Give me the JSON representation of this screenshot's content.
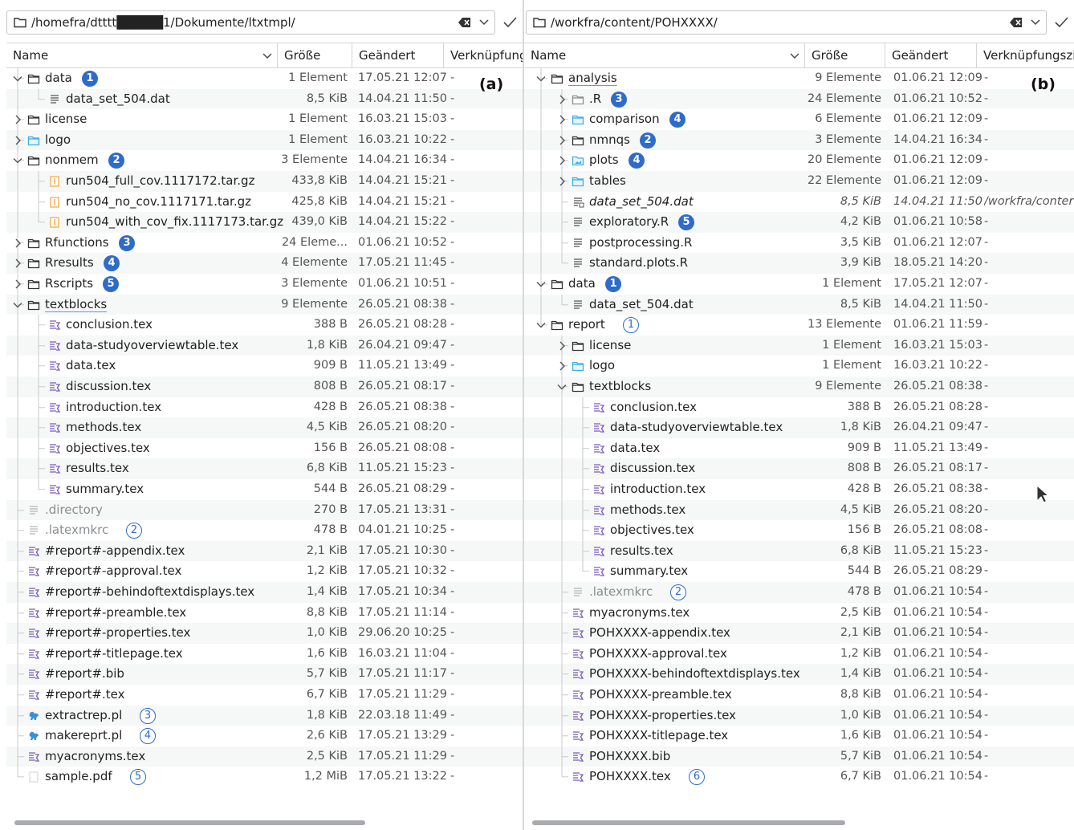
{
  "columns": {
    "name": "Name",
    "size": "Größe",
    "modified": "Geändert",
    "link_a": "Verknüpfung",
    "link_b": "Verknüpfungszi"
  },
  "left": {
    "path": "/homefra/dtttt█████1/Dokumente/ltxtmpl/",
    "label": "(a)",
    "rows": [
      {
        "d": 0,
        "exp": "open",
        "icon": "folder",
        "name": "data",
        "size": "1 Element",
        "date": "17.05.21 12:07",
        "link": "-",
        "badge": "1",
        "bt": "filled"
      },
      {
        "d": 1,
        "exp": "",
        "icon": "text",
        "name": "data_set_504.dat",
        "size": "8,5 KiB",
        "date": "14.04.21 11:50",
        "link": "-"
      },
      {
        "d": 0,
        "exp": "closed",
        "icon": "folder",
        "name": "license",
        "size": "1 Element",
        "date": "16.03.21 15:03",
        "link": "-"
      },
      {
        "d": 0,
        "exp": "closed",
        "icon": "folder-blue",
        "name": "logo",
        "size": "1 Element",
        "date": "16.03.21 10:22",
        "link": "-"
      },
      {
        "d": 0,
        "exp": "open",
        "icon": "folder",
        "name": "nonmem",
        "size": "3 Elemente",
        "date": "14.04.21 16:34",
        "link": "-",
        "badge": "2",
        "bt": "filled"
      },
      {
        "d": 1,
        "exp": "",
        "icon": "archive",
        "name": "run504_full_cov.1117172.tar.gz",
        "size": "433,8 KiB",
        "date": "14.04.21 15:21",
        "link": "-"
      },
      {
        "d": 1,
        "exp": "",
        "icon": "archive",
        "name": "run504_no_cov.1117171.tar.gz",
        "size": "425,8 KiB",
        "date": "14.04.21 15:21",
        "link": "-"
      },
      {
        "d": 1,
        "exp": "",
        "icon": "archive",
        "name": "run504_with_cov_fix.1117173.tar.gz",
        "size": "439,0 KiB",
        "date": "14.04.21 15:22",
        "link": "-"
      },
      {
        "d": 0,
        "exp": "closed",
        "icon": "folder",
        "name": "Rfunctions",
        "size": "24 Eleme...",
        "date": "01.06.21 10:52",
        "link": "-",
        "badge": "3",
        "bt": "filled"
      },
      {
        "d": 0,
        "exp": "closed",
        "icon": "folder",
        "name": "Rresults",
        "size": "4 Elemente",
        "date": "17.05.21 11:45",
        "link": "-",
        "badge": "4",
        "bt": "filled"
      },
      {
        "d": 0,
        "exp": "closed",
        "icon": "folder",
        "name": "Rscripts",
        "size": "3 Elemente",
        "date": "01.06.21 10:51",
        "link": "-",
        "badge": "5",
        "bt": "filled"
      },
      {
        "d": 0,
        "exp": "open",
        "icon": "folder",
        "name": "textblocks",
        "size": "9 Elemente",
        "date": "26.05.21 08:38",
        "link": "-",
        "under": true
      },
      {
        "d": 1,
        "exp": "",
        "icon": "tex",
        "name": "conclusion.tex",
        "size": "388 B",
        "date": "26.05.21 08:28",
        "link": "-"
      },
      {
        "d": 1,
        "exp": "",
        "icon": "tex",
        "name": "data-studyoverviewtable.tex",
        "size": "1,8 KiB",
        "date": "26.04.21 09:47",
        "link": "-"
      },
      {
        "d": 1,
        "exp": "",
        "icon": "tex",
        "name": "data.tex",
        "size": "909 B",
        "date": "11.05.21 13:49",
        "link": "-"
      },
      {
        "d": 1,
        "exp": "",
        "icon": "tex",
        "name": "discussion.tex",
        "size": "808 B",
        "date": "26.05.21 08:17",
        "link": "-"
      },
      {
        "d": 1,
        "exp": "",
        "icon": "tex",
        "name": "introduction.tex",
        "size": "428 B",
        "date": "26.05.21 08:38",
        "link": "-"
      },
      {
        "d": 1,
        "exp": "",
        "icon": "tex",
        "name": "methods.tex",
        "size": "4,5 KiB",
        "date": "26.05.21 08:20",
        "link": "-"
      },
      {
        "d": 1,
        "exp": "",
        "icon": "tex",
        "name": "objectives.tex",
        "size": "156 B",
        "date": "26.05.21 08:08",
        "link": "-"
      },
      {
        "d": 1,
        "exp": "",
        "icon": "tex",
        "name": "results.tex",
        "size": "6,8 KiB",
        "date": "11.05.21 15:23",
        "link": "-"
      },
      {
        "d": 1,
        "exp": "",
        "icon": "tex",
        "name": "summary.tex",
        "size": "544 B",
        "date": "26.05.21 08:29",
        "link": "-"
      },
      {
        "d": 0,
        "exp": "",
        "icon": "text-dim",
        "name": ".directory",
        "size": "270 B",
        "date": "17.05.21 13:31",
        "link": "-",
        "dim": true
      },
      {
        "d": 0,
        "exp": "",
        "icon": "text-dim",
        "name": ".latexmkrc",
        "size": "478 B",
        "date": "04.01.21 10:25",
        "link": "-",
        "dim": true,
        "badge": "2",
        "bt": "outline"
      },
      {
        "d": 0,
        "exp": "",
        "icon": "tex",
        "name": "#report#-appendix.tex",
        "size": "2,1 KiB",
        "date": "17.05.21 10:30",
        "link": "-"
      },
      {
        "d": 0,
        "exp": "",
        "icon": "tex",
        "name": "#report#-approval.tex",
        "size": "1,2 KiB",
        "date": "17.05.21 10:32",
        "link": "-"
      },
      {
        "d": 0,
        "exp": "",
        "icon": "tex",
        "name": "#report#-behindoftextdisplays.tex",
        "size": "1,4 KiB",
        "date": "17.05.21 10:34",
        "link": "-"
      },
      {
        "d": 0,
        "exp": "",
        "icon": "tex",
        "name": "#report#-preamble.tex",
        "size": "8,8 KiB",
        "date": "17.05.21 11:14",
        "link": "-"
      },
      {
        "d": 0,
        "exp": "",
        "icon": "tex",
        "name": "#report#-properties.tex",
        "size": "1,0 KiB",
        "date": "29.06.20 10:25",
        "link": "-"
      },
      {
        "d": 0,
        "exp": "",
        "icon": "tex",
        "name": "#report#-titlepage.tex",
        "size": "1,6 KiB",
        "date": "16.03.21 11:04",
        "link": "-"
      },
      {
        "d": 0,
        "exp": "",
        "icon": "tex",
        "name": "#report#.bib",
        "size": "5,7 KiB",
        "date": "17.05.21 11:17",
        "link": "-"
      },
      {
        "d": 0,
        "exp": "",
        "icon": "tex",
        "name": "#report#.tex",
        "size": "6,7 KiB",
        "date": "17.05.21 11:29",
        "link": "-"
      },
      {
        "d": 0,
        "exp": "",
        "icon": "perl",
        "name": "extractrep.pl",
        "size": "1,8 KiB",
        "date": "22.03.18 11:49",
        "link": "-",
        "badge": "3",
        "bt": "outline"
      },
      {
        "d": 0,
        "exp": "",
        "icon": "perl",
        "name": "makereprt.pl",
        "size": "2,6 KiB",
        "date": "17.05.21 13:29",
        "link": "-",
        "badge": "4",
        "bt": "outline"
      },
      {
        "d": 0,
        "exp": "",
        "icon": "tex",
        "name": "myacronyms.tex",
        "size": "2,5 KiB",
        "date": "17.05.21 11:29",
        "link": "-"
      },
      {
        "d": 0,
        "exp": "",
        "icon": "pdf",
        "name": "sample.pdf",
        "size": "1,2 MiB",
        "date": "17.05.21 13:22",
        "link": "-",
        "badge": "5",
        "bt": "outline"
      }
    ]
  },
  "right": {
    "path": "/workfra/content/POHXXXX/",
    "label": "(b)",
    "rows": [
      {
        "d": 0,
        "exp": "open",
        "icon": "folder",
        "name": "analysis",
        "size": "9 Elemente",
        "date": "01.06.21 12:09",
        "link": "-",
        "under": true
      },
      {
        "d": 1,
        "exp": "closed",
        "icon": "folder-dim",
        "name": ".R",
        "size": "24 Elemente",
        "date": "01.06.21 10:52",
        "link": "-",
        "badge": "3",
        "bt": "filled"
      },
      {
        "d": 1,
        "exp": "closed",
        "icon": "folder-blue",
        "name": "comparison",
        "size": "6 Elemente",
        "date": "01.06.21 12:09",
        "link": "-",
        "badge": "4",
        "bt": "filled"
      },
      {
        "d": 1,
        "exp": "closed",
        "icon": "folder",
        "name": "nmnqs",
        "size": "3 Elemente",
        "date": "14.04.21 16:34",
        "link": "-",
        "badge": "2",
        "bt": "filled"
      },
      {
        "d": 1,
        "exp": "closed",
        "icon": "folder-img",
        "name": "plots",
        "size": "20 Elemente",
        "date": "01.06.21 12:09",
        "link": "-",
        "badge": "4",
        "bt": "filled"
      },
      {
        "d": 1,
        "exp": "closed",
        "icon": "folder-blue",
        "name": "tables",
        "size": "22 Elemente",
        "date": "01.06.21 12:09",
        "link": "-"
      },
      {
        "d": 1,
        "exp": "",
        "icon": "text-link",
        "name": "data_set_504.dat",
        "size": "8,5 KiB",
        "date": "14.04.21 11:50",
        "link": "/workfra/conter",
        "italic": true
      },
      {
        "d": 1,
        "exp": "",
        "icon": "text",
        "name": "exploratory.R",
        "size": "4,2 KiB",
        "date": "01.06.21 10:58",
        "link": "-",
        "badge": "5",
        "bt": "filled"
      },
      {
        "d": 1,
        "exp": "",
        "icon": "text",
        "name": "postprocessing.R",
        "size": "3,5 KiB",
        "date": "01.06.21 12:07",
        "link": "-"
      },
      {
        "d": 1,
        "exp": "",
        "icon": "text",
        "name": "standard.plots.R",
        "size": "3,9 KiB",
        "date": "18.05.21 14:20",
        "link": "-"
      },
      {
        "d": 0,
        "exp": "open",
        "icon": "folder",
        "name": "data",
        "size": "1 Element",
        "date": "17.05.21 12:07",
        "link": "-",
        "badge": "1",
        "bt": "filled"
      },
      {
        "d": 1,
        "exp": "",
        "icon": "text",
        "name": "data_set_504.dat",
        "size": "8,5 KiB",
        "date": "14.04.21 11:50",
        "link": "-"
      },
      {
        "d": 0,
        "exp": "open",
        "icon": "folder",
        "name": "report",
        "size": "13 Elemente",
        "date": "01.06.21 11:59",
        "link": "-",
        "badge": "1",
        "bt": "outline"
      },
      {
        "d": 1,
        "exp": "closed",
        "icon": "folder",
        "name": "license",
        "size": "1 Element",
        "date": "16.03.21 15:03",
        "link": "-"
      },
      {
        "d": 1,
        "exp": "closed",
        "icon": "folder-blue",
        "name": "logo",
        "size": "1 Element",
        "date": "16.03.21 10:22",
        "link": "-"
      },
      {
        "d": 1,
        "exp": "open",
        "icon": "folder",
        "name": "textblocks",
        "size": "9 Elemente",
        "date": "26.05.21 08:38",
        "link": "-"
      },
      {
        "d": 2,
        "exp": "",
        "icon": "tex",
        "name": "conclusion.tex",
        "size": "388 B",
        "date": "26.05.21 08:28",
        "link": "-"
      },
      {
        "d": 2,
        "exp": "",
        "icon": "tex",
        "name": "data-studyoverviewtable.tex",
        "size": "1,8 KiB",
        "date": "26.04.21 09:47",
        "link": "-"
      },
      {
        "d": 2,
        "exp": "",
        "icon": "tex",
        "name": "data.tex",
        "size": "909 B",
        "date": "11.05.21 13:49",
        "link": "-"
      },
      {
        "d": 2,
        "exp": "",
        "icon": "tex",
        "name": "discussion.tex",
        "size": "808 B",
        "date": "26.05.21 08:17",
        "link": "-"
      },
      {
        "d": 2,
        "exp": "",
        "icon": "tex",
        "name": "introduction.tex",
        "size": "428 B",
        "date": "26.05.21 08:38",
        "link": "-"
      },
      {
        "d": 2,
        "exp": "",
        "icon": "tex",
        "name": "methods.tex",
        "size": "4,5 KiB",
        "date": "26.05.21 08:20",
        "link": "-"
      },
      {
        "d": 2,
        "exp": "",
        "icon": "tex",
        "name": "objectives.tex",
        "size": "156 B",
        "date": "26.05.21 08:08",
        "link": "-"
      },
      {
        "d": 2,
        "exp": "",
        "icon": "tex",
        "name": "results.tex",
        "size": "6,8 KiB",
        "date": "11.05.21 15:23",
        "link": "-"
      },
      {
        "d": 2,
        "exp": "",
        "icon": "tex",
        "name": "summary.tex",
        "size": "544 B",
        "date": "26.05.21 08:29",
        "link": "-"
      },
      {
        "d": 1,
        "exp": "",
        "icon": "text-dim",
        "name": ".latexmkrc",
        "size": "478 B",
        "date": "01.06.21 10:54",
        "link": "-",
        "dim": true,
        "badge": "2",
        "bt": "outline"
      },
      {
        "d": 1,
        "exp": "",
        "icon": "tex",
        "name": "myacronyms.tex",
        "size": "2,5 KiB",
        "date": "01.06.21 10:54",
        "link": "-"
      },
      {
        "d": 1,
        "exp": "",
        "icon": "tex",
        "name": "POHXXXX-appendix.tex",
        "size": "2,1 KiB",
        "date": "01.06.21 10:54",
        "link": "-"
      },
      {
        "d": 1,
        "exp": "",
        "icon": "tex",
        "name": "POHXXXX-approval.tex",
        "size": "1,2 KiB",
        "date": "01.06.21 10:54",
        "link": "-"
      },
      {
        "d": 1,
        "exp": "",
        "icon": "tex",
        "name": "POHXXXX-behindoftextdisplays.tex",
        "size": "1,4 KiB",
        "date": "01.06.21 10:54",
        "link": "-"
      },
      {
        "d": 1,
        "exp": "",
        "icon": "tex",
        "name": "POHXXXX-preamble.tex",
        "size": "8,8 KiB",
        "date": "01.06.21 10:54",
        "link": "-"
      },
      {
        "d": 1,
        "exp": "",
        "icon": "tex",
        "name": "POHXXXX-properties.tex",
        "size": "1,0 KiB",
        "date": "01.06.21 10:54",
        "link": "-"
      },
      {
        "d": 1,
        "exp": "",
        "icon": "tex",
        "name": "POHXXXX-titlepage.tex",
        "size": "1,6 KiB",
        "date": "01.06.21 10:54",
        "link": "-"
      },
      {
        "d": 1,
        "exp": "",
        "icon": "tex",
        "name": "POHXXXX.bib",
        "size": "5,7 KiB",
        "date": "01.06.21 10:54",
        "link": "-"
      },
      {
        "d": 1,
        "exp": "",
        "icon": "tex",
        "name": "POHXXXX.tex",
        "size": "6,7 KiB",
        "date": "01.06.21 10:54",
        "link": "-",
        "badge": "6",
        "bt": "outline"
      }
    ]
  }
}
